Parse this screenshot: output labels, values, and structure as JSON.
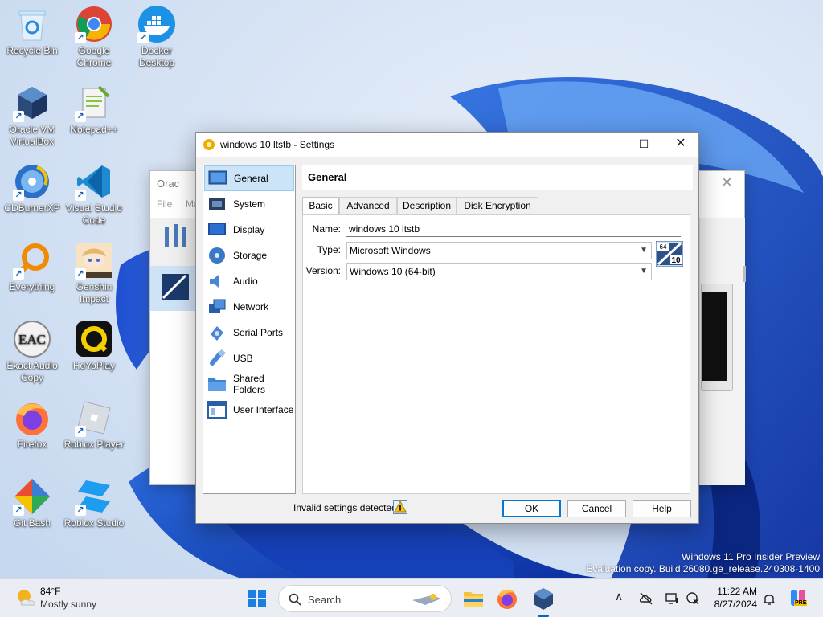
{
  "desktop": {
    "icons": [
      {
        "label": "Recycle Bin",
        "icon": "recycle-bin-icon"
      },
      {
        "label": "Google Chrome",
        "icon": "chrome-icon"
      },
      {
        "label": "Docker Desktop",
        "icon": "docker-icon"
      },
      {
        "label": "Oracle VM VirtualBox",
        "icon": "virtualbox-icon"
      },
      {
        "label": "Notepad++",
        "icon": "notepadpp-icon"
      },
      {
        "label": "CDBurnerXP",
        "icon": "cdburnerxp-icon"
      },
      {
        "label": "Visual Studio Code",
        "icon": "vscode-icon"
      },
      {
        "label": "Everything",
        "icon": "everything-icon"
      },
      {
        "label": "Genshin Impact",
        "icon": "genshin-icon"
      },
      {
        "label": "Exact Audio Copy",
        "icon": "eac-icon"
      },
      {
        "label": "HoYoPlay",
        "icon": "hoyoplay-icon"
      },
      {
        "label": "Firefox",
        "icon": "firefox-icon"
      },
      {
        "label": "Roblox Player",
        "icon": "roblox-icon"
      },
      {
        "label": "Git Bash",
        "icon": "git-bash-icon"
      },
      {
        "label": "Roblox Studio",
        "icon": "roblox-studio-icon"
      }
    ],
    "eac_glyph": "EAC"
  },
  "background_window": {
    "title": "Orac",
    "menu_file": "File",
    "menu_machine": "Mac"
  },
  "dialog": {
    "title": "windows 10 ltstb - Settings",
    "categories": [
      {
        "label": "General",
        "icon": "general-icon"
      },
      {
        "label": "System",
        "icon": "system-icon"
      },
      {
        "label": "Display",
        "icon": "display-icon"
      },
      {
        "label": "Storage",
        "icon": "storage-icon"
      },
      {
        "label": "Audio",
        "icon": "audio-icon"
      },
      {
        "label": "Network",
        "icon": "network-icon"
      },
      {
        "label": "Serial Ports",
        "icon": "serial-ports-icon"
      },
      {
        "label": "USB",
        "icon": "usb-icon"
      },
      {
        "label": "Shared Folders",
        "icon": "shared-folders-icon"
      },
      {
        "label": "User Interface",
        "icon": "user-interface-icon"
      }
    ],
    "selected_category": "General",
    "header": "General",
    "tabs": [
      "Basic",
      "Advanced",
      "Description",
      "Disk Encryption"
    ],
    "active_tab": "Basic",
    "form": {
      "name_label": "Name:",
      "name_value": "windows 10 ltstb",
      "type_label": "Type:",
      "type_value": "Microsoft Windows",
      "version_label": "Version:",
      "version_value": "Windows 10 (64-bit)",
      "os_badge_bits": "64",
      "os_badge_version": "10"
    },
    "status_text": "Invalid settings detected",
    "buttons": {
      "ok": "OK",
      "cancel": "Cancel",
      "help": "Help"
    }
  },
  "watermark": {
    "line1": "Windows 11 Pro Insider Preview",
    "line2": "Evaluation copy. Build 26080.ge_release.240308-1400"
  },
  "taskbar": {
    "weather_temp": "84°F",
    "weather_condition": "Mostly sunny",
    "search_placeholder": "Search",
    "clock_time": "11:22 AM",
    "clock_date": "8/27/2024",
    "copilot_badge": "PRE"
  },
  "colors": {
    "selection": "#cce4f7",
    "accent": "#0078d7",
    "taskbar": "#eaeef4"
  }
}
